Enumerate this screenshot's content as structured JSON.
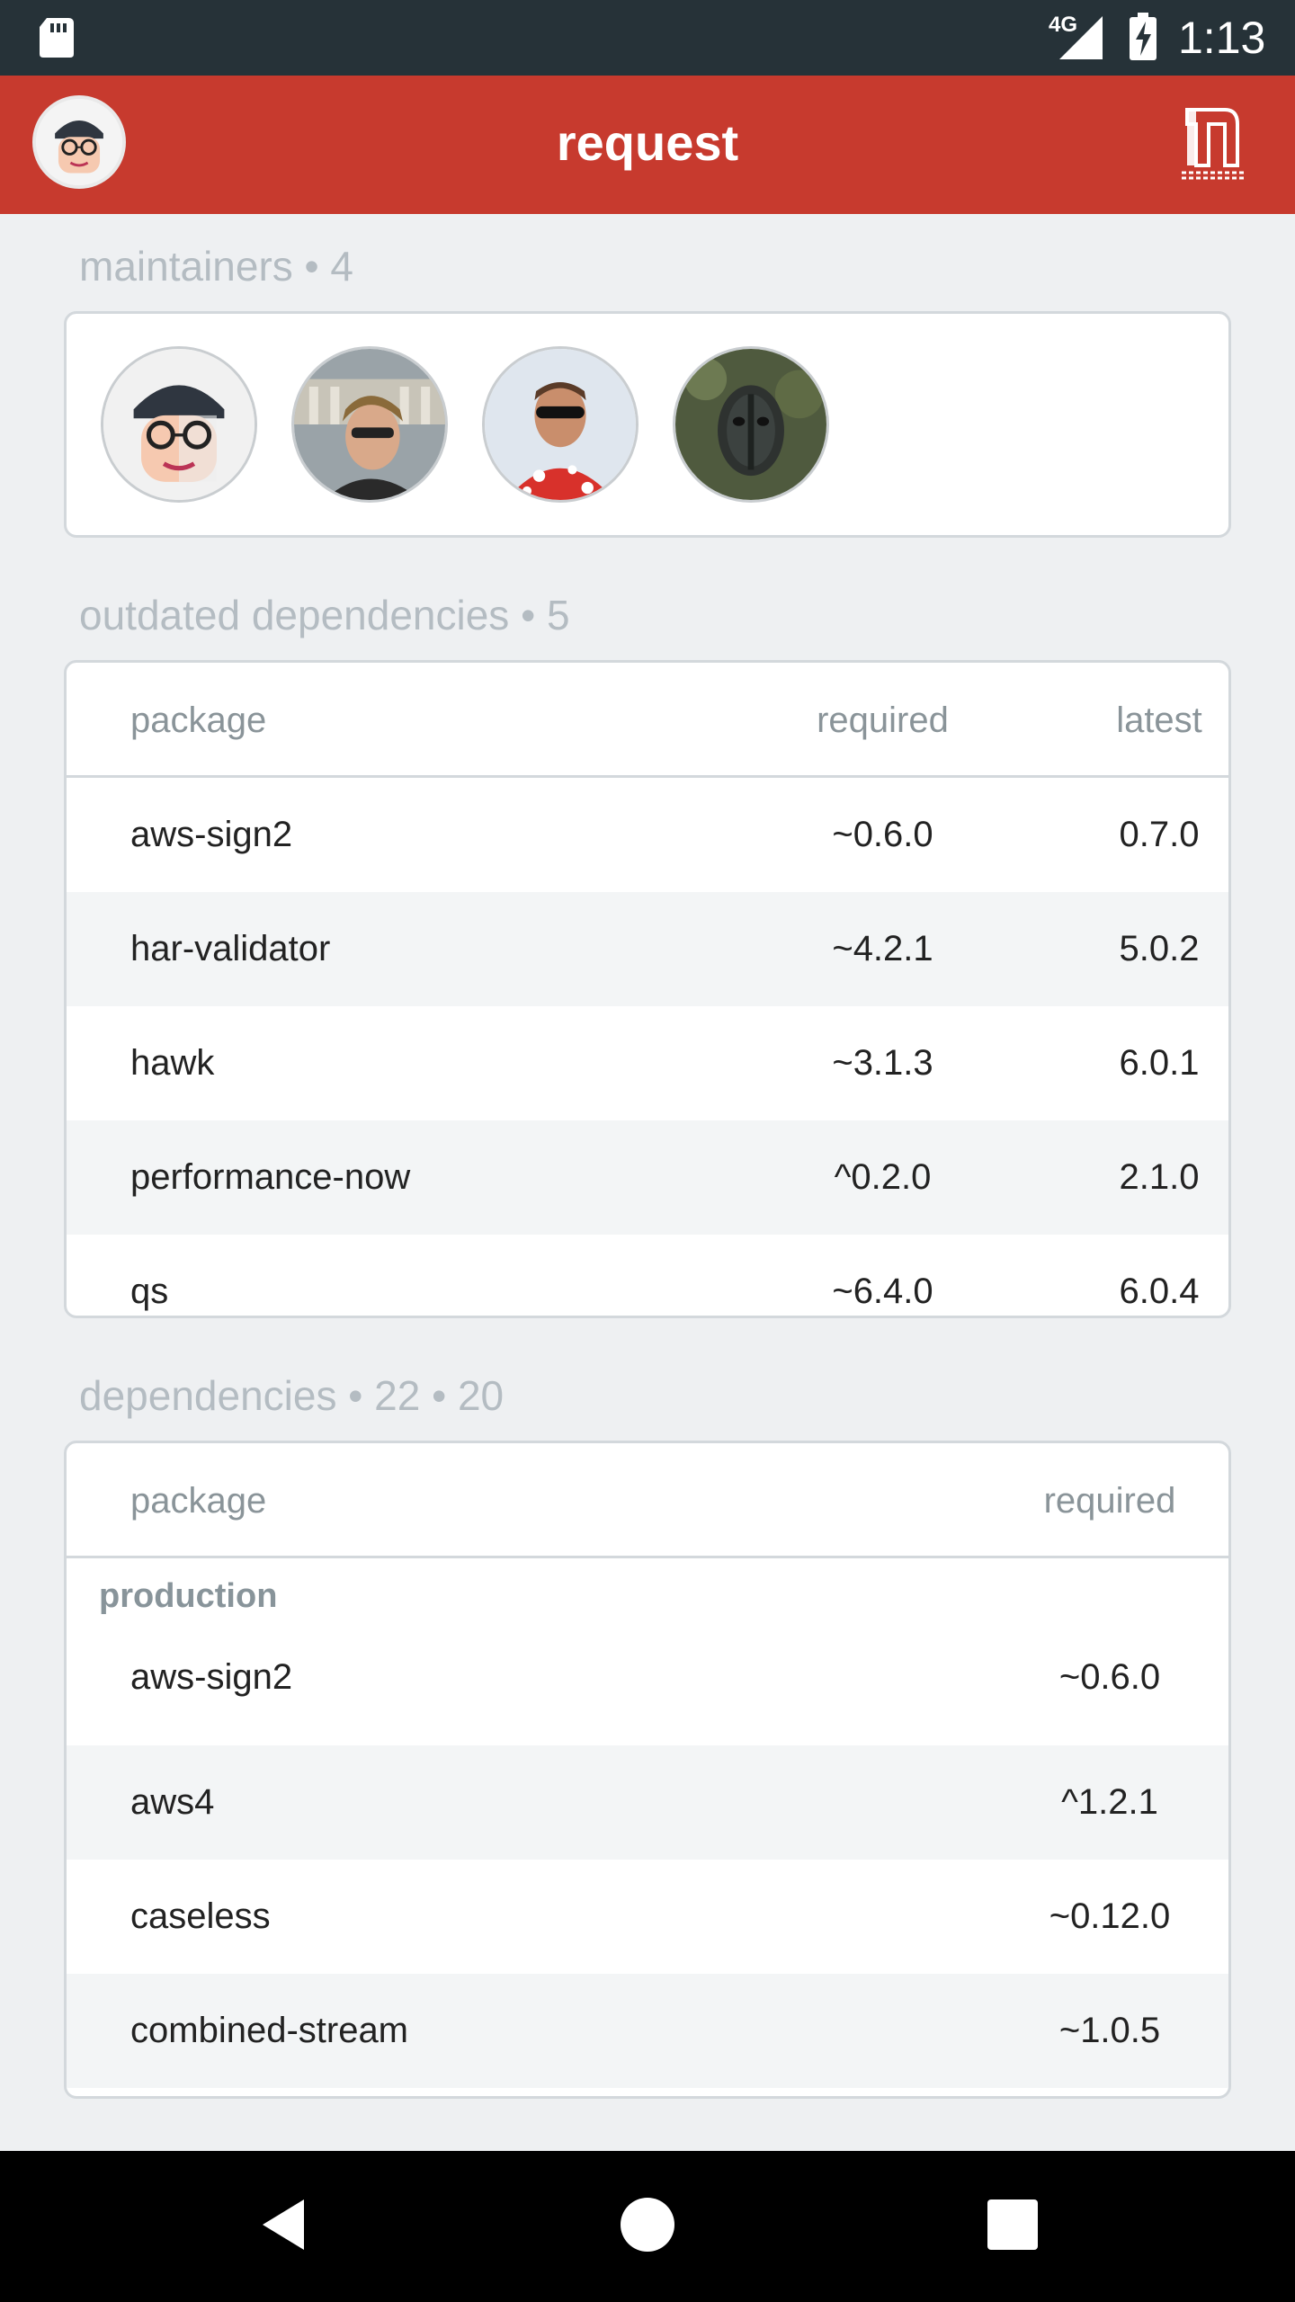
{
  "status_bar": {
    "network": "4G",
    "time": "1:13"
  },
  "app_bar": {
    "title": "request"
  },
  "maintainers": {
    "title": "maintainers • 4",
    "avatars": [
      "maintainer-avatar-1",
      "maintainer-avatar-2",
      "maintainer-avatar-3",
      "maintainer-avatar-4"
    ]
  },
  "outdated": {
    "title": "outdated dependencies • 5",
    "headers": {
      "package": "package",
      "required": "required",
      "latest": "latest"
    },
    "rows": [
      {
        "package": "aws-sign2",
        "required": "~0.6.0",
        "latest": "0.7.0"
      },
      {
        "package": "har-validator",
        "required": "~4.2.1",
        "latest": "5.0.2"
      },
      {
        "package": "hawk",
        "required": "~3.1.3",
        "latest": "6.0.1"
      },
      {
        "package": "performance-now",
        "required": "^0.2.0",
        "latest": "2.1.0"
      },
      {
        "package": "qs",
        "required": "~6.4.0",
        "latest": "6.0.4"
      }
    ]
  },
  "dependencies": {
    "title": "dependencies • 22 • 20",
    "headers": {
      "package": "package",
      "required": "required"
    },
    "group": "production",
    "rows": [
      {
        "package": "aws-sign2",
        "required": "~0.6.0"
      },
      {
        "package": "aws4",
        "required": "^1.2.1"
      },
      {
        "package": "caseless",
        "required": "~0.12.0"
      },
      {
        "package": "combined-stream",
        "required": "~1.0.5"
      }
    ]
  },
  "colors": {
    "app_bar": "#c73a2e",
    "status_bar": "#263238",
    "background": "#eef0f2"
  }
}
